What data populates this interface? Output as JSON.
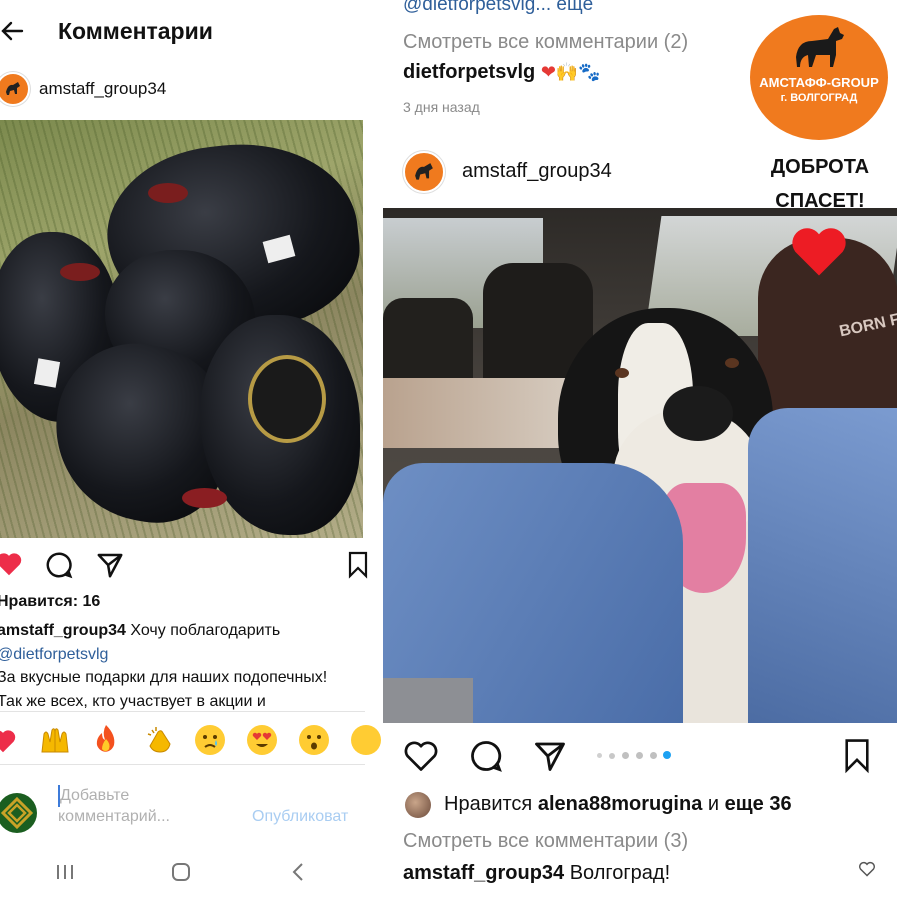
{
  "left": {
    "header": {
      "back_glyph": "←",
      "title": "Комментарии"
    },
    "post": {
      "username": "amstaff_group34"
    },
    "likes_text": "Нравится: 16",
    "caption": {
      "username": "amstaff_group34",
      "text_1": "Хочу поблагодарить",
      "mention": "@dietforpetsvlg",
      "line_3": "За вкусные подарки для наших подопечных!",
      "line_4": "Так же всех, кто участвует в акции и"
    },
    "reactions": [
      "heart",
      "raised-hands",
      "fire",
      "clapping-hands",
      "crying-face",
      "heart-eyes-face",
      "surprised-face"
    ],
    "comment_input": {
      "placeholder_1": "Добавьте",
      "placeholder_2": "комментарий...",
      "publish_label": "Опубликоват"
    }
  },
  "right": {
    "top": {
      "mention_more": "@dietforpetsvlg... ещё",
      "view_all_1": "Смотреть все комментарии (2)",
      "comment_user": "dietforpetsvlg",
      "comment_emoji": "❤🙌🐾",
      "time": "3 дня назад"
    },
    "logo": {
      "title": "АМСТАФФ-GROUP",
      "city": "г. ВОЛГОГРАД",
      "slogan_1": "ДОБРОТА",
      "slogan_2": "СПАСЕТ!"
    },
    "post": {
      "username": "amstaff_group34"
    },
    "photo_text": "BORN FR",
    "likes": {
      "prefix": "Нравится",
      "user": "alena88morugina",
      "middle": "и",
      "rest": "еще 36"
    },
    "view_all_2": "Смотреть все комментарии (3)",
    "bottom_comment": {
      "username": "amstaff_group34",
      "text": "Волгоград!"
    }
  },
  "colors": {
    "like_red": "#ed2d49",
    "mention_blue": "#2f5f9a",
    "logo_orange": "#f07a1e",
    "carousel_active": "#1da1f2"
  }
}
